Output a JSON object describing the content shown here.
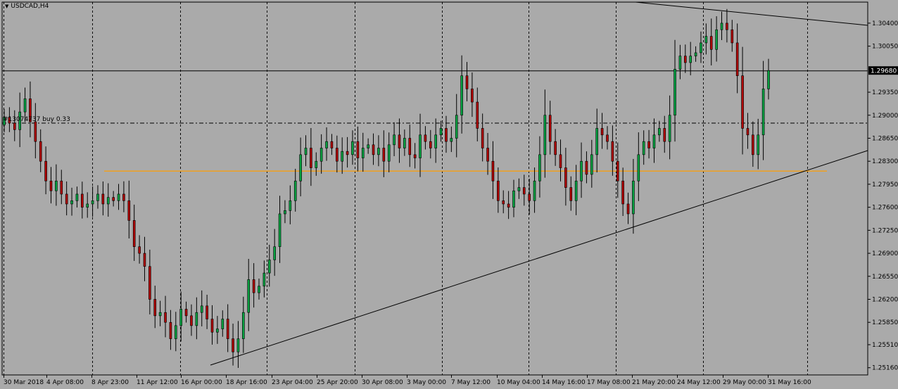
{
  "chart": {
    "title": "USDCAD,H4",
    "trade_label": "#13074737 buy 0.33",
    "current_price": "1.29680",
    "background": "#aaaaaa",
    "bull_color": "#00a040",
    "bear_color": "#b00000",
    "support_line_color": "#f0a020"
  },
  "chart_data": {
    "type": "candlestick",
    "symbol": "USDCAD",
    "timeframe": "H4",
    "y_ticks": [
      "1.30400",
      "1.30050",
      "1.29350",
      "1.29000",
      "1.28650",
      "1.28300",
      "1.27950",
      "1.27600",
      "1.27250",
      "1.26900",
      "1.26550",
      "1.26200",
      "1.25850",
      "1.25510",
      "1.25160"
    ],
    "y_range": [
      1.2505,
      1.3072
    ],
    "x_ticks": [
      "30 Mar 2018",
      "4 Apr 08:00",
      "8 Apr 23:00",
      "11 Apr 12:00",
      "16 Apr 00:00",
      "18 Apr 16:00",
      "23 Apr 04:00",
      "25 Apr 20:00",
      "30 Apr 08:00",
      "3 May 00:00",
      "7 May 12:00",
      "10 May 04:00",
      "14 May 16:00",
      "17 May 08:00",
      "21 May 20:00",
      "24 May 12:00",
      "29 May 00:00",
      "31 May 16:00"
    ],
    "grid": true,
    "current_price": 1.2968,
    "trade_price": 1.2888,
    "support_level": 1.2815,
    "closes": [
      1.2897,
      1.2888,
      1.2878,
      1.2905,
      1.2925,
      1.289,
      1.286,
      1.283,
      1.28,
      1.2785,
      1.28,
      1.278,
      1.2765,
      1.277,
      1.278,
      1.276,
      1.2765,
      1.277,
      1.278,
      1.2765,
      1.2775,
      1.277,
      1.278,
      1.277,
      1.274,
      1.27,
      1.269,
      1.267,
      1.262,
      1.2595,
      1.26,
      1.2585,
      1.256,
      1.258,
      1.2605,
      1.2595,
      1.258,
      1.26,
      1.261,
      1.259,
      1.257,
      1.2575,
      1.259,
      1.256,
      1.254,
      1.256,
      1.26,
      1.265,
      1.263,
      1.264,
      1.266,
      1.268,
      1.27,
      1.275,
      1.2755,
      1.277,
      1.28,
      1.284,
      1.285,
      1.282,
      1.283,
      1.285,
      1.286,
      1.285,
      1.283,
      1.2845,
      1.284,
      1.286,
      1.2835,
      1.285,
      1.2855,
      1.284,
      1.285,
      1.283,
      1.2855,
      1.287,
      1.285,
      1.2865,
      1.284,
      1.2835,
      1.287,
      1.286,
      1.285,
      1.287,
      1.288,
      1.286,
      1.2865,
      1.29,
      1.296,
      1.294,
      1.292,
      1.288,
      1.285,
      1.283,
      1.28,
      1.277,
      1.2765,
      1.276,
      1.2785,
      1.279,
      1.278,
      1.277,
      1.28,
      1.284,
      1.29,
      1.286,
      1.284,
      1.282,
      1.279,
      1.277,
      1.28,
      1.283,
      1.281,
      1.284,
      1.288,
      1.287,
      1.286,
      1.283,
      1.28,
      1.2765,
      1.275,
      1.28,
      1.284,
      1.286,
      1.285,
      1.287,
      1.288,
      1.286,
      1.29,
      1.297,
      1.299,
      1.298,
      1.299,
      1.2995,
      1.301,
      1.302,
      1.3,
      1.303,
      1.304,
      1.303,
      1.301,
      1.296,
      1.288,
      1.287,
      1.284,
      1.287,
      1.294,
      1.2968
    ]
  }
}
